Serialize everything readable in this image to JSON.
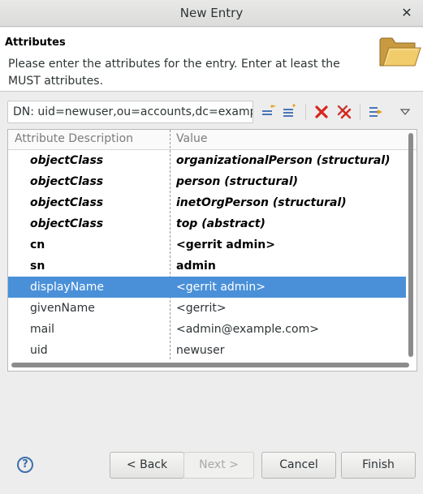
{
  "window": {
    "title": "New Entry",
    "close_glyph": "✕"
  },
  "header": {
    "title": "Attributes",
    "description": "Please enter the attributes for the entry. Enter at least the MUST attributes.",
    "icon": "folder-icon"
  },
  "dn": {
    "text": "DN: uid=newuser,ou=accounts,dc=example,dc=com"
  },
  "toolbar": {
    "icons": [
      "new-attribute-icon",
      "new-value-icon",
      "delete-value-icon",
      "delete-all-icon",
      "show-operational-attributes-icon",
      "view-menu-icon"
    ]
  },
  "table": {
    "headers": {
      "attribute": "Attribute Description",
      "value": "Value"
    },
    "rows": [
      {
        "attribute": "objectClass",
        "value": "organizationalPerson (structural)"
      },
      {
        "attribute": "objectClass",
        "value": "person (structural)"
      },
      {
        "attribute": "objectClass",
        "value": "inetOrgPerson (structural)"
      },
      {
        "attribute": "objectClass",
        "value": "top (abstract)"
      },
      {
        "attribute": "cn",
        "value": "<gerrit admin>"
      },
      {
        "attribute": "sn",
        "value": "admin"
      },
      {
        "attribute": "displayName",
        "value": "<gerrit admin>"
      },
      {
        "attribute": "givenName",
        "value": "<gerrit>"
      },
      {
        "attribute": "mail",
        "value": "<admin@example.com>"
      },
      {
        "attribute": "uid",
        "value": "newuser"
      }
    ],
    "selected_color": "#4a90d9"
  },
  "buttons": {
    "help": "?",
    "back": "< Back",
    "next": "Next >",
    "cancel": "Cancel",
    "finish": "Finish"
  }
}
